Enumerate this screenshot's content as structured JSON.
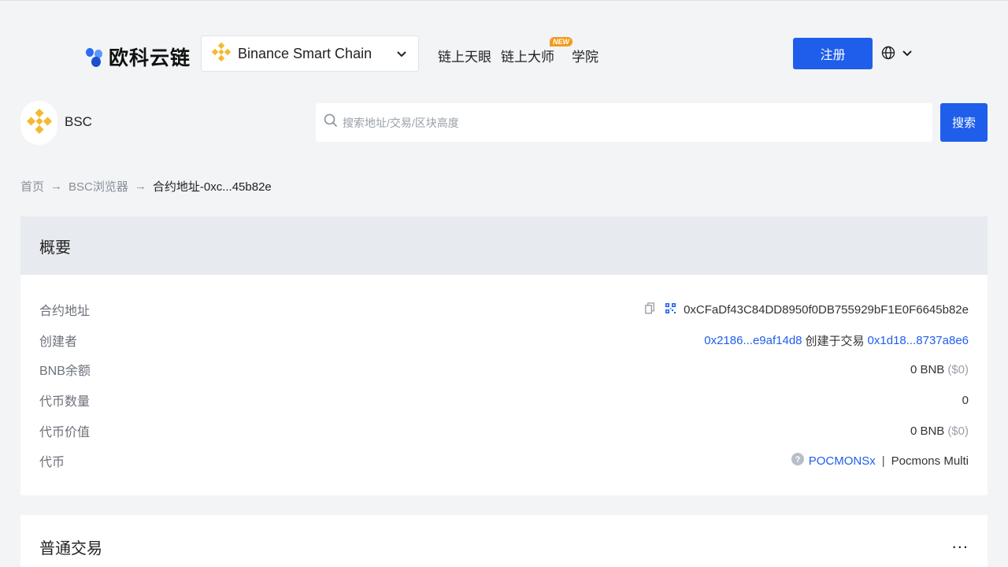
{
  "header": {
    "logo_text": "欧科云链",
    "chain_select": {
      "name": "Binance Smart Chain",
      "icon": "bnb-icon"
    },
    "nav": [
      {
        "label": "链上天眼"
      },
      {
        "label": "链上大师",
        "badge": "NEW"
      },
      {
        "label": "学院"
      }
    ],
    "register_label": "注册",
    "language_icon": "globe-icon"
  },
  "chain_bar": {
    "chain_name": "BSC",
    "search_placeholder": "搜索地址/交易/区块高度",
    "search_button": "搜索"
  },
  "breadcrumb": {
    "items": [
      "首页",
      "BSC浏览器",
      "合约地址-0xc...45b82e"
    ],
    "separator": "→"
  },
  "overview": {
    "title": "概要",
    "rows": {
      "contract_address": {
        "label": "合约地址",
        "value": "0xCFaDf43C84DD8950f0DB755929bF1E0F6645b82e"
      },
      "creator": {
        "label": "创建者",
        "creator_addr": "0x2186...e9af14d8",
        "created_text": "创建于交易",
        "tx_hash": "0x1d18...8737a8e6"
      },
      "bnb_balance": {
        "label": "BNB余额",
        "amount": "0 BNB",
        "usd": "($0)"
      },
      "token_count": {
        "label": "代币数量",
        "value": "0"
      },
      "token_value": {
        "label": "代币价值",
        "amount": "0 BNB",
        "usd": "($0)"
      },
      "token": {
        "label": "代币",
        "symbol": "POCMONSx",
        "separator": "|",
        "name": "Pocmons Multi"
      }
    }
  },
  "transactions": {
    "title": "普通交易",
    "more_label": "..."
  },
  "colors": {
    "primary": "#1e5eeb",
    "bnb_yellow": "#f3ba2f",
    "header_bg": "#f2f4f6"
  }
}
